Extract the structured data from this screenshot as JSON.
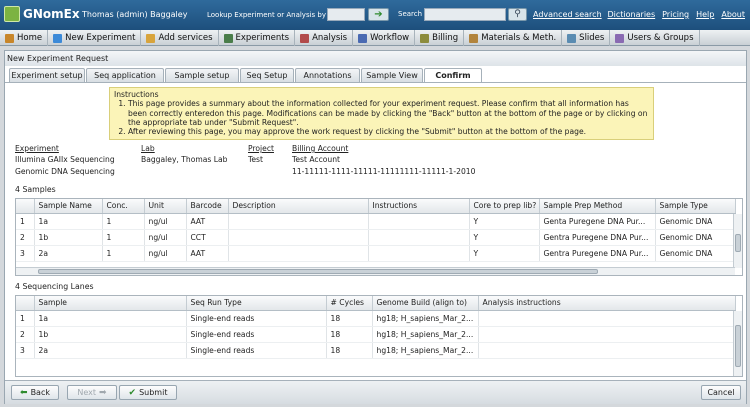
{
  "app": {
    "logo": "GNomEx",
    "user": "Thomas (admin) Baggaley",
    "lookup_label": "Lookup Experiment or Analysis by #",
    "go_icon": "arrow-right-icon",
    "search_label": "Search",
    "search_icon": "magnifier-icon",
    "advanced_search": "Advanced search",
    "links": [
      "Dictionaries",
      "Pricing",
      "Help",
      "About"
    ]
  },
  "nav": [
    {
      "label": "Home",
      "icon": "home-icon",
      "color": "#c8862a"
    },
    {
      "label": "New Experiment",
      "icon": "flask-icon",
      "color": "#3c8ad8"
    },
    {
      "label": "Add services",
      "icon": "services-icon",
      "color": "#d8a43c"
    },
    {
      "label": "Experiments",
      "icon": "experiments-icon",
      "color": "#4a7d4a"
    },
    {
      "label": "Analysis",
      "icon": "analysis-icon",
      "color": "#b24a4a"
    },
    {
      "label": "Workflow",
      "icon": "workflow-icon",
      "color": "#4a6ab2"
    },
    {
      "label": "Billing",
      "icon": "billing-icon",
      "color": "#8c8c3c"
    },
    {
      "label": "Materials & Meth.",
      "icon": "materials-icon",
      "color": "#b2843c"
    },
    {
      "label": "Slides",
      "icon": "slides-icon",
      "color": "#5a8cb2"
    },
    {
      "label": "Users & Groups",
      "icon": "users-icon",
      "color": "#8a6ab2"
    }
  ],
  "panel": {
    "title": "New Experiment Request",
    "tabs": [
      {
        "label": "Experiment setup",
        "active": false
      },
      {
        "label": "Seq application",
        "active": false
      },
      {
        "label": "Sample setup",
        "active": false
      },
      {
        "label": "Seq Setup",
        "active": false
      },
      {
        "label": "Annotations",
        "active": false
      },
      {
        "label": "Sample View",
        "active": false
      },
      {
        "label": "Confirm",
        "active": true
      }
    ],
    "instructions": {
      "heading": "Instructions",
      "items": [
        "This page provides a summary about the information collected for your experiment request.  Please confirm that all information has been correctly enteredon this page. Modifications can be made by clicking the \"Back\" button at the bottom of the page or by clicking on the appropriate tab under \"Submit Request\".",
        "After reviewing this page, you may approve the work request by clicking the \"Submit\" button at the bottom of the page."
      ]
    },
    "summary": {
      "experiment_header": "Experiment",
      "experiment_lines": [
        "Illumina GAIIx Sequencing",
        "Genomic DNA Sequencing"
      ],
      "lab_header": "Lab",
      "lab_value": "Baggaley, Thomas Lab",
      "project_header": "Project",
      "project_value": "Test",
      "billing_header": "Billing Account",
      "billing_name": "Test Account",
      "billing_number": "11-11111-1111-11111-11111111-11111-1-2010"
    },
    "samples": {
      "label": "4 Samples",
      "columns": [
        "",
        "Sample Name",
        "Conc.",
        "Unit",
        "Barcode",
        "Description",
        "Instructions",
        "Core to prep lib?",
        "Sample Prep Method",
        "Sample Type"
      ],
      "rows": [
        [
          "1",
          "1a",
          "1",
          "ng/ul",
          "AAT",
          "",
          "",
          "Y",
          "Genta Puregene DNA Pur...",
          "Genomic DNA"
        ],
        [
          "2",
          "1b",
          "1",
          "ng/ul",
          "CCT",
          "",
          "",
          "Y",
          "Gentra Puregene DNA Pur...",
          "Genomic DNA"
        ],
        [
          "3",
          "2a",
          "1",
          "ng/ul",
          "AAT",
          "",
          "",
          "Y",
          "Gentra Puregene DNA Pur...",
          "Genomic DNA"
        ]
      ]
    },
    "lanes": {
      "label": "4 Sequencing Lanes",
      "columns": [
        "",
        "Sample",
        "Seq Run Type",
        "# Cycles",
        "Genome Build (align to)",
        "Analysis instructions"
      ],
      "rows": [
        [
          "1",
          "1a",
          "Single-end reads",
          "18",
          "hg18; H_sapiens_Mar_2...",
          ""
        ],
        [
          "2",
          "1b",
          "Single-end reads",
          "18",
          "hg18; H_sapiens_Mar_2...",
          ""
        ],
        [
          "3",
          "2a",
          "Single-end reads",
          "18",
          "hg18; H_sapiens_Mar_2...",
          ""
        ]
      ]
    },
    "buttons": {
      "back": "Back",
      "next": "Next",
      "submit": "Submit",
      "cancel": "Cancel"
    }
  }
}
